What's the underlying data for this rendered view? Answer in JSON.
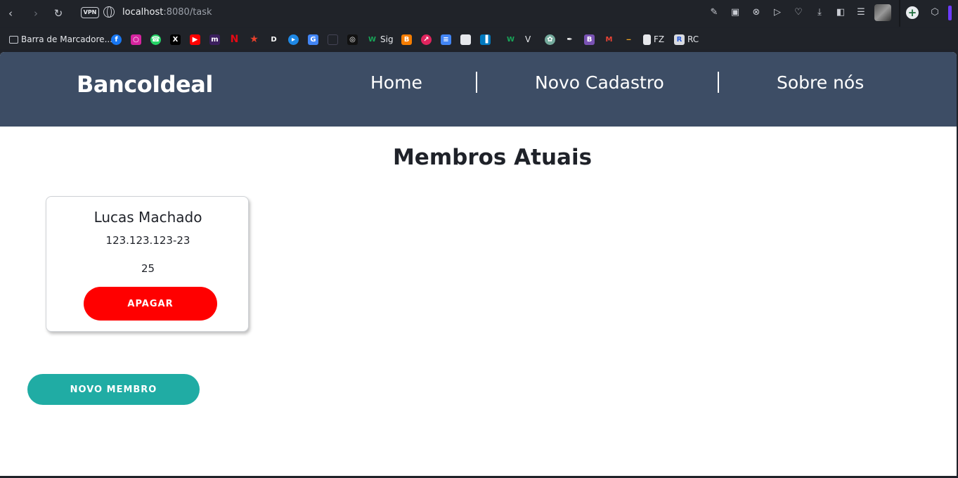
{
  "browser": {
    "url_host": "localhost",
    "url_path": ":8080/task",
    "vpn_label": "VPN",
    "back_icon": "chevron-left-icon",
    "forward_icon": "chevron-right-icon",
    "reload_icon": "reload-icon"
  },
  "bookmarks": {
    "folder_label": "Barra de Marcadore...",
    "sig_label": "Sig",
    "v_label": "V",
    "fz_label": "FZ",
    "rc_label": "RC"
  },
  "header": {
    "brand": "BancoIdeal",
    "nav": [
      {
        "label": "Home"
      },
      {
        "label": "Novo Cadastro"
      },
      {
        "label": "Sobre nós"
      }
    ]
  },
  "main": {
    "title": "Membros Atuais",
    "members": [
      {
        "name": "Lucas Machado",
        "cpf": "123.123.123-23",
        "age": "25",
        "delete_label": "APAGAR"
      }
    ],
    "new_member_label": "NOVO MEMBRO"
  },
  "colors": {
    "header_bg": "#3d4d65",
    "delete_button": "#ff0000",
    "new_member_button": "#20aca4"
  }
}
